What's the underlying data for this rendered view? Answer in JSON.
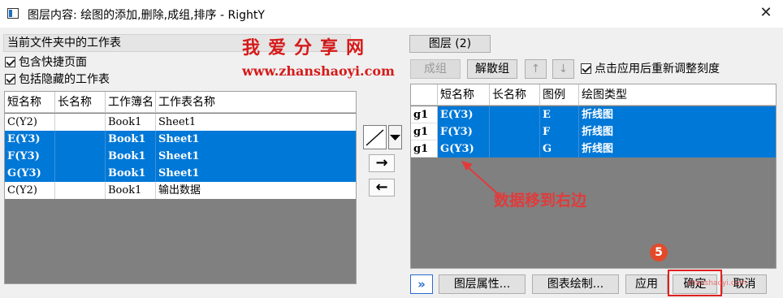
{
  "window": {
    "title": "图层内容: 绘图的添加,删除,成组,排序 - RightY",
    "close_glyph": "✕"
  },
  "left": {
    "folder_combo": "当前文件夹中的工作表",
    "checks": [
      {
        "label": "包含快捷页面",
        "checked": true
      },
      {
        "label": "包括隐藏的工作表",
        "checked": true
      }
    ],
    "columns": [
      "短名称",
      "长名称",
      "工作簿名",
      "工作表名称"
    ],
    "rows": [
      {
        "short": "C(Y2)",
        "long": "",
        "book": "Book1",
        "sheet": "Sheet1",
        "selected": false
      },
      {
        "short": "E(Y3)",
        "long": "",
        "book": "Book1",
        "sheet": "Sheet1",
        "selected": true
      },
      {
        "short": "F(Y3)",
        "long": "",
        "book": "Book1",
        "sheet": "Sheet1",
        "selected": true
      },
      {
        "short": "G(Y3)",
        "long": "",
        "book": "Book1",
        "sheet": "Sheet1",
        "selected": true
      },
      {
        "short": "C(Y2)",
        "long": "",
        "book": "Book1",
        "sheet": "输出数据",
        "selected": false
      }
    ]
  },
  "middle": {
    "add_arrow": "→",
    "remove_arrow": "←"
  },
  "watermark": {
    "cn": "我爱分享网",
    "url": "www.zhanshaoyi.com",
    "small": "zhanshaoyi.com"
  },
  "right": {
    "layer_tab": "图层 (2)",
    "group_btn": "成组",
    "ungroup_btn": "解散组",
    "up_glyph": "↑",
    "down_glyph": "↓",
    "rescale_check": {
      "label": "点击应用后重新调整刻度",
      "checked": true
    },
    "columns": [
      "",
      "短名称",
      "长名称",
      "图例",
      "绘图类型"
    ],
    "rows": [
      {
        "group": "g1",
        "short": "E(Y3)",
        "long": "",
        "legend": "E",
        "type": "折线图"
      },
      {
        "group": "g1",
        "short": "F(Y3)",
        "long": "",
        "legend": "F",
        "type": "折线图"
      },
      {
        "group": "g1",
        "short": "G(Y3)",
        "long": "",
        "legend": "G",
        "type": "折线图"
      }
    ],
    "annotation": "数据移到右边",
    "step_badge": "5"
  },
  "bottom": {
    "expand": "»",
    "layer_props": "图层属性...",
    "plot_setup": "图表绘制...",
    "apply": "应用",
    "ok": "确定",
    "cancel": "取消"
  },
  "colors": {
    "selection": "#0078d7",
    "annotation_red": "#e23a3a",
    "grid_bg": "#808080"
  }
}
